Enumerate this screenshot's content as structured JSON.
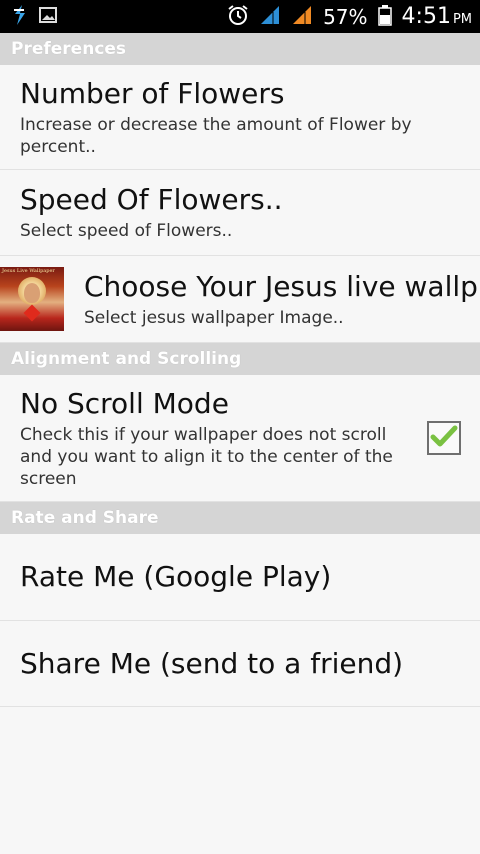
{
  "status_bar": {
    "battery_percent": "57%",
    "time": "4:51",
    "ampm": "PM",
    "icons": [
      "usb-debug-icon",
      "image-notification-icon",
      "alarm-icon",
      "signal-icon",
      "signal-icon",
      "battery-icon"
    ]
  },
  "sections": {
    "preferences": "Preferences",
    "alignment": "Alignment and Scrolling",
    "rate_share": "Rate and Share"
  },
  "items": {
    "number_flowers": {
      "title": "Number of Flowers",
      "summary": "Increase or decrease the amount of Flower by percent.."
    },
    "speed_flowers": {
      "title": "Speed Of Flowers..",
      "summary": "Select speed of Flowers.."
    },
    "choose_wallpaper": {
      "title": "Choose Your Jesus live wallp",
      "summary": "Select jesus wallpaper Image..",
      "thumb_caption": "Jesus Live Wallpaper"
    },
    "no_scroll": {
      "title": "No Scroll Mode",
      "summary": "Check this if your wallpaper does not scroll and you want to align it to the center of the screen",
      "checked": true
    },
    "rate_me": {
      "title": "Rate Me (Google Play)"
    },
    "share_me": {
      "title": "Share Me (send to a friend)"
    }
  },
  "colors": {
    "section_bg": "#d5d5d5",
    "check_green": "#7ac142"
  }
}
